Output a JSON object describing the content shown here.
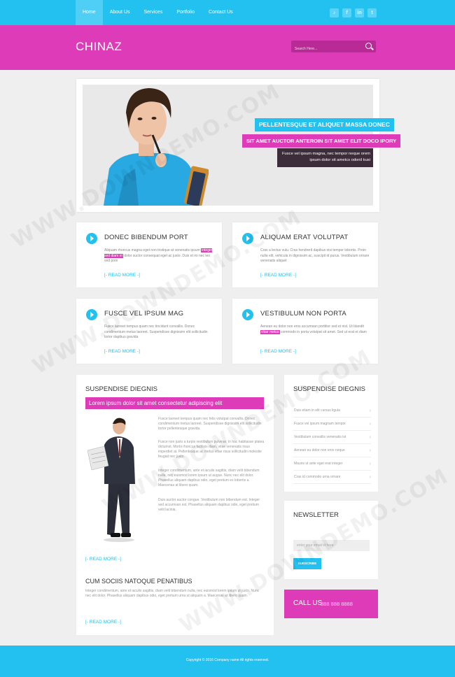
{
  "nav": {
    "items": [
      "Home",
      "About Us",
      "Services",
      "Portfolio",
      "Contact Us"
    ],
    "social": [
      "♪",
      "f",
      "in",
      "t"
    ]
  },
  "header": {
    "logo": "CHINAZ",
    "search_placeholder": "Search Here..."
  },
  "slider": {
    "caption1": "PELLENTESQUE ET ALIQUET MASSA DONEC",
    "caption2": "SIT AMET AUCTOR ANTEROIN SIT AMET ELIT DOCO IPORY",
    "caption3": "Fusce vel ipsum magna, nec tempor neque orem ipsum dolor sit ametcs odonil kusi"
  },
  "features": [
    {
      "title": "DONEC BIBENDUM PORT",
      "text_a": "Aliquam rhoncus magna eget non tristique at venenatis ipsum ",
      "highlight": "integer sed diam et",
      "text_b": " dolor suctor consequat eget ac justo. Duis et mi nec leo sed pore",
      "more": "[- READ MORE -]"
    },
    {
      "title": "ALIQUAM ERAT VOLUTPAT",
      "text_a": "Cras a lectus vulu. Cras hendrerit dapibus nisi tempor lobortis. Proin nulla elit, vehicula in dignissim ac, suscipit id purus. Vestibulum ornare venenatis aliquet",
      "highlight": "",
      "text_b": "",
      "more": "[- READ MORE -]"
    },
    {
      "title": "FUSCE VEL IPSUM MAG",
      "text_a": "Fusce laoreet tempus quam nec tincidunt convallis. Donec condimentum metus laoreet. Suspendisse dignissim elit sollicitudin tortor dapibus gravida",
      "highlight": "",
      "text_b": "",
      "more": "[- READ MORE -]"
    },
    {
      "title": "VESTIBULUM NON PORTA",
      "text_a": "Aenean eu dolor non eros accumsan porttitor sed et nisl. Ut blandit ",
      "highlight": "vitae metus",
      "text_b": " commodo in porta volutpat sit amet. Sed ut erat et diam",
      "more": "[- READ MORE -]"
    }
  ],
  "main": {
    "heading": "SUSPENDISE DIEGNIS",
    "bar": "Lorem ipsum dolor sit amet consectetur adipiscing elit",
    "p1": "Fusce laoreet tempus quam nec felis volutpat convallis. Donec condimentum metus laoreet. Suspendisse dignissim elit sollicitudin tortor pellentesque gravida.",
    "p2": "Fusce non justo a turpis vestibulum pulvinar. In hac habitasse platea dictumst. Morbi rhoncus facilisis diam, vitae venenatis risus imperdiet at. Pellentesque ac metus vitae risus sollicitudin molestie feugiat nec justo.",
    "p3": "Integer condimentum, ante et iaculis sagittis, diam velit bibendum nulla, nec euismod lorem ipsum ut augue. Nunc nec elit dolor. Phasellus aliquam dapibus odio, eget pretium ex lobortis a. Maecenas at libero quam.",
    "p4": "Duis auctor auctor congue. Vestibulum non bibendum est. Integer sed accumsan est. Phasellus aliquam dapibus odio, eget pretium velit lacinia.",
    "more1": "[- READ MORE -]",
    "subheading": "CUM SOCIIS NATOQUE PENATIBUS",
    "p5": "Integer condimentum, ante et iaculis sagittis, diam velit bibendum nulla, nec euismod lorem ipsum ut justo. Nunc nec elit dolor. Phasellus aliquam dapibus odio, eget pretium urna ut aliquam a. Maecenas at libero quam.",
    "more2": "[- READ MORE -]"
  },
  "sidebar": {
    "heading": "SUSPENDISE DIEGNIS",
    "items": [
      "Duis etiam in elit cursus ligula",
      "Fusce vel ipsum magnam tempor",
      "Vestibulum convallis venenatis ist",
      "Aenean eu dolor non eros neque",
      "Mauris ut ante eget erat integer",
      "Cras id commodo urna ornare"
    ],
    "newsletter_heading": "NEWSLETTER",
    "newsletter_placeholder": "enter your email id here",
    "subscribe": "SUBSCRIBE",
    "call_label": "CALL US",
    "call_number": "888 888 8888"
  },
  "footer": {
    "copyright": "Copyright © 2016 Company name All rights reserved."
  },
  "watermark": "WWW.DOWNDEMO.COM"
}
